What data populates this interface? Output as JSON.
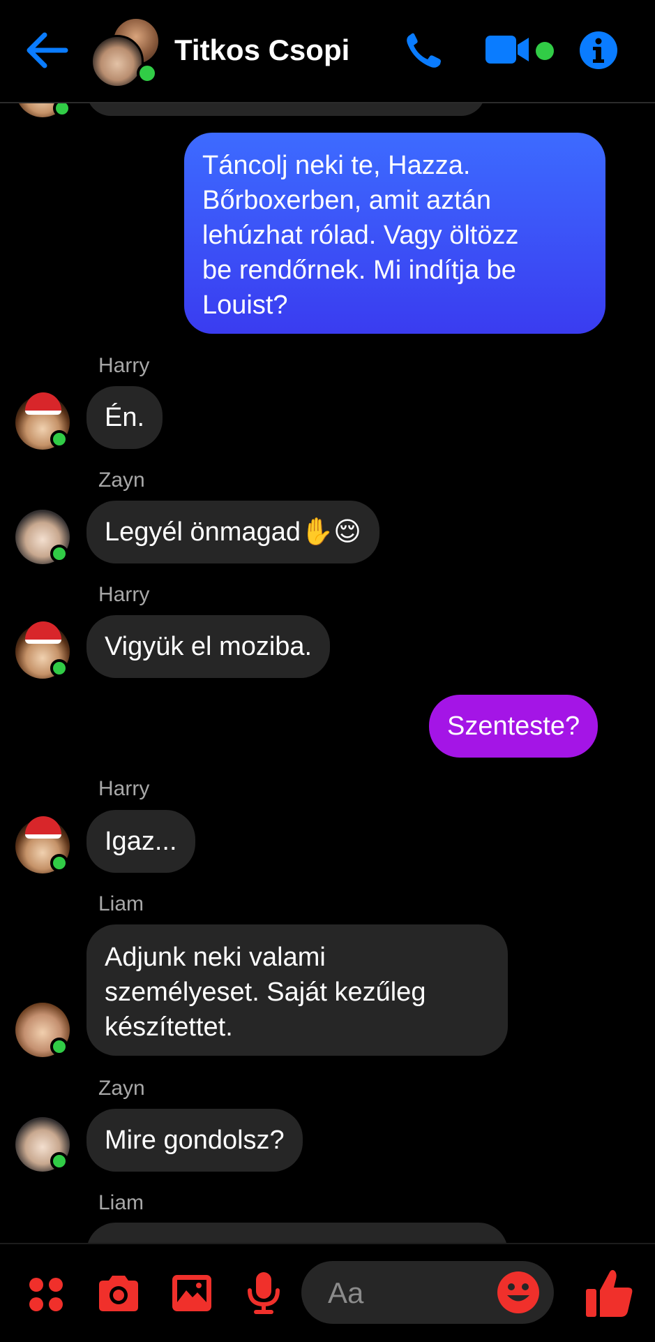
{
  "colors": {
    "accent_blue": "#0a7cff",
    "icon_red": "#f0302b",
    "bubble_incoming": "#262626",
    "bubble_outgoing_blue": "#3a49f5",
    "bubble_outgoing_purple": "#a415e6",
    "online": "#31cc46"
  },
  "header": {
    "title": "Titkos Csopi",
    "icons": [
      "arrow-left-icon",
      "phone-icon",
      "video-camera-icon",
      "info-icon"
    ]
  },
  "messages": [
    {
      "type": "outgoing",
      "text": "Táncolj neki te, Hazza.\nBőrboxerben, amit aztán\nlehúzhat rólad. Vagy öltözz\nbe rendőrnek. Mi indítja be\nLouist?"
    },
    {
      "type": "incoming",
      "sender": "Harry",
      "text": "Én."
    },
    {
      "type": "incoming",
      "sender": "Zayn",
      "text": "Legyél önmagad✋😌"
    },
    {
      "type": "incoming",
      "sender": "Harry",
      "text": "Vigyük el moziba."
    },
    {
      "type": "outgoing",
      "text": "Szenteste?"
    },
    {
      "type": "incoming",
      "sender": "Harry",
      "text": "Igaz..."
    },
    {
      "type": "incoming",
      "sender": "Liam",
      "text": "Adjunk neki valami\nszemélyeset. Saját kezűleg\nkészítettet."
    },
    {
      "type": "incoming",
      "sender": "Zayn",
      "text": "Mire gondolsz?"
    },
    {
      "type": "incoming",
      "sender": "Liam",
      "text": ""
    }
  ],
  "composer": {
    "placeholder": "Aa",
    "icons": [
      "apps-grid-icon",
      "camera-icon",
      "image-icon",
      "microphone-icon",
      "emoji-icon",
      "thumbs-up-icon"
    ]
  }
}
